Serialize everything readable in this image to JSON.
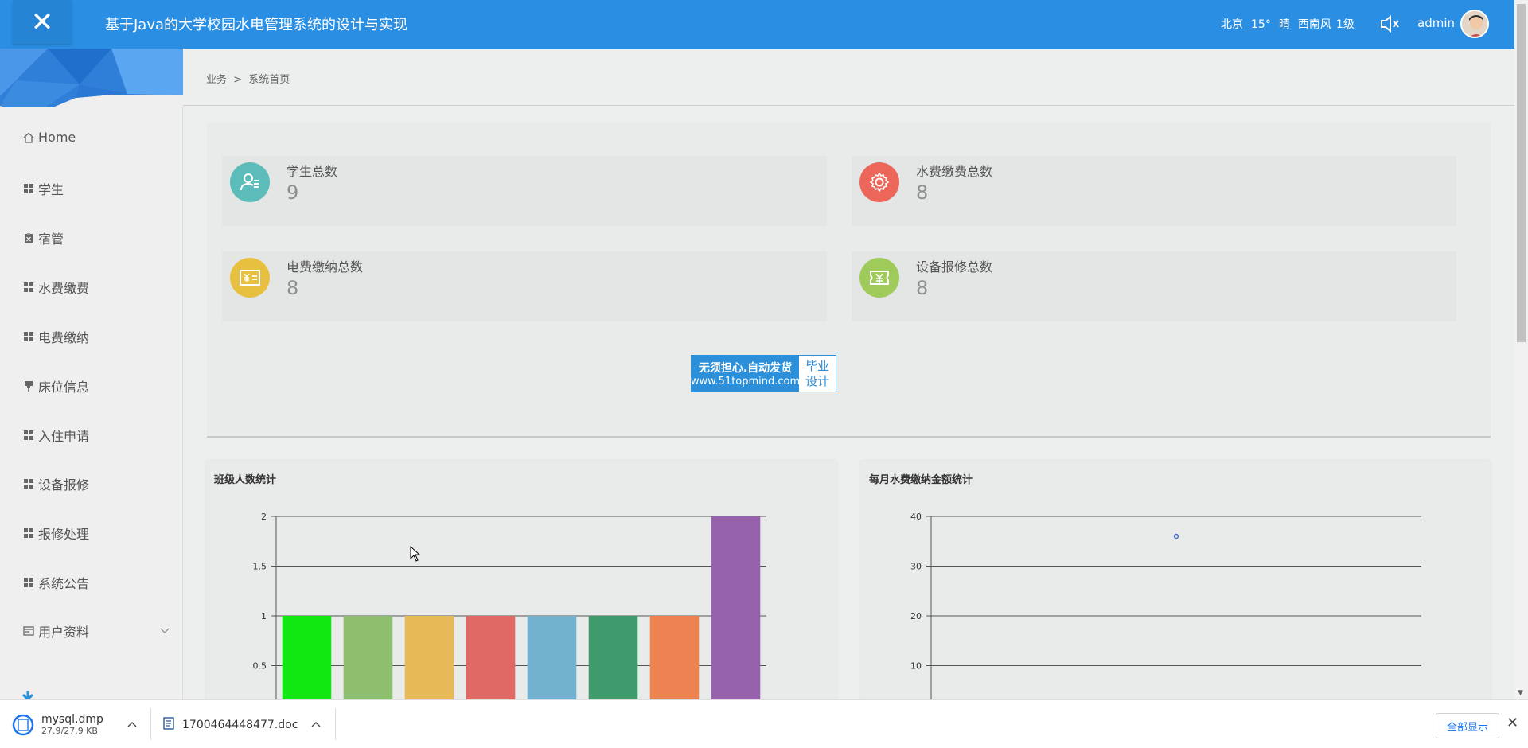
{
  "header": {
    "title": "基于Java的大学校园水电管理系统的设计与实现",
    "weather": {
      "city": "北京",
      "temp": "15°",
      "condition": "晴",
      "wind": "西南风",
      "level": "1级"
    },
    "username": "admin"
  },
  "sidebar": {
    "items": [
      {
        "label": "Home",
        "icon": "home-icon"
      },
      {
        "label": "学生",
        "icon": "grid-icon"
      },
      {
        "label": "宿管",
        "icon": "clipboard-icon"
      },
      {
        "label": "水费缴费",
        "icon": "grid-icon"
      },
      {
        "label": "电费缴纳",
        "icon": "grid-icon"
      },
      {
        "label": "床位信息",
        "icon": "pin-icon"
      },
      {
        "label": "入住申请",
        "icon": "grid-icon"
      },
      {
        "label": "设备报修",
        "icon": "grid-icon"
      },
      {
        "label": "报修处理",
        "icon": "grid-icon"
      },
      {
        "label": "系统公告",
        "icon": "grid-icon"
      },
      {
        "label": "用户资料",
        "icon": "card-icon"
      }
    ]
  },
  "breadcrumb": {
    "root": "业务",
    "sep": ">",
    "current": "系统首页"
  },
  "stats": [
    {
      "label": "学生总数",
      "value": "9",
      "color": "#5bbcb9"
    },
    {
      "label": "水费缴费总数",
      "value": "8",
      "color": "#ec6659"
    },
    {
      "label": "电费缴纳总数",
      "value": "8",
      "color": "#e8c040"
    },
    {
      "label": "设备报修总数",
      "value": "8",
      "color": "#9fcb5a"
    }
  ],
  "ad": {
    "line1": "无须担心.自动发货",
    "line2": "www.51topmind.com",
    "tag1": "毕业",
    "tag2": "设计"
  },
  "charts": {
    "left_title": "班级人数统计",
    "right_title": "每月水费缴纳金额统计"
  },
  "chart_data": [
    {
      "type": "bar",
      "title": "班级人数统计",
      "ylim": [
        0,
        2
      ],
      "yticks": [
        "2",
        "1.5",
        "1",
        "0.5"
      ],
      "values": [
        1,
        1,
        1,
        1,
        1,
        1,
        1,
        2
      ],
      "colors": [
        "#11e811",
        "#8dbf6e",
        "#e8b957",
        "#e06865",
        "#72b2cf",
        "#3f9a6c",
        "#ec8350",
        "#9662ad"
      ]
    },
    {
      "type": "scatter",
      "title": "每月水费缴纳金额统计",
      "ylim": [
        0,
        40
      ],
      "yticks": [
        "40",
        "30",
        "20",
        "10"
      ],
      "points": [
        {
          "y": 36
        }
      ]
    }
  ],
  "downloads": [
    {
      "name": "mysql.dmp",
      "size": "27.9/27.9 KB"
    },
    {
      "name": "1700464448477.doc"
    }
  ],
  "download_bar": {
    "show_all": "全部显示"
  }
}
